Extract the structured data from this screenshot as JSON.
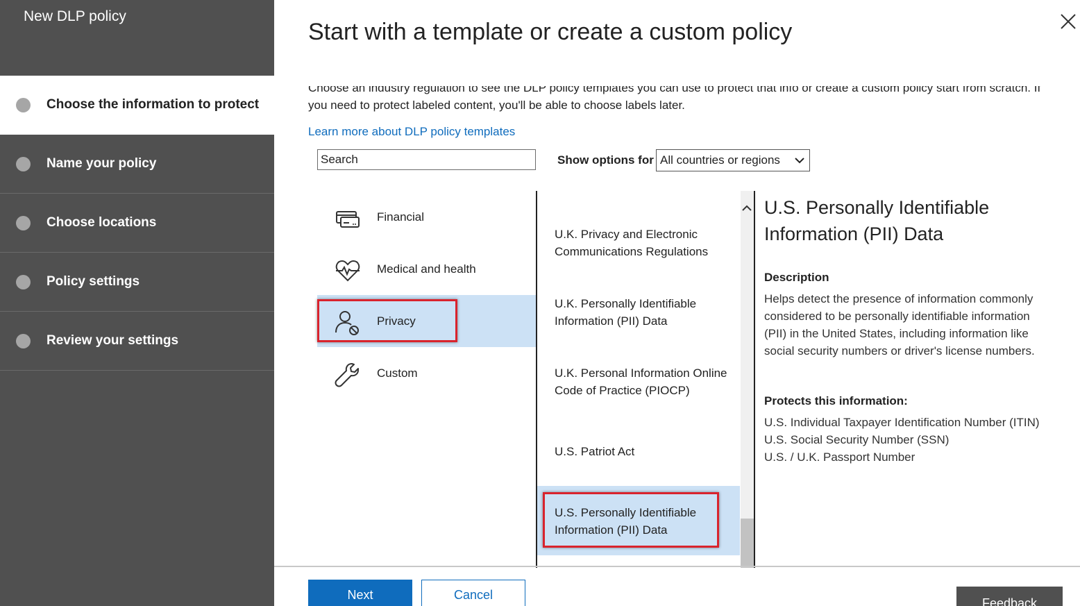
{
  "sidebar": {
    "title": "New DLP policy",
    "steps": [
      {
        "label": "Choose the information to protect",
        "active": true
      },
      {
        "label": "Name your policy"
      },
      {
        "label": "Choose locations"
      },
      {
        "label": "Policy settings"
      },
      {
        "label": "Review your settings"
      }
    ]
  },
  "main": {
    "title": "Start with a template or create a custom policy",
    "intro": "Choose an industry regulation to see the DLP policy templates you can use to protect that info or create a custom policy start from scratch. If you need to protect labeled content, you'll be able to choose labels later.",
    "learn_more": "Learn more about DLP policy templates",
    "search": {
      "value": "Search"
    },
    "show_options_label": "Show options for",
    "region_select": "All countries or regions"
  },
  "categories": [
    {
      "label": "Financial",
      "icon": "credit-card-icon"
    },
    {
      "label": "Medical and health",
      "icon": "heart-pulse-icon"
    },
    {
      "label": "Privacy",
      "icon": "person-blocked-icon",
      "selected": true
    },
    {
      "label": "Custom",
      "icon": "wrench-icon"
    }
  ],
  "templates": [
    {
      "label": "U.K. Privacy and Electronic Communications Regulations"
    },
    {
      "label": "U.K. Personally Identifiable Information (PII) Data"
    },
    {
      "label": "U.K. Personal Information Online Code of Practice (PIOCP)"
    },
    {
      "label": "U.S. Patriot Act"
    },
    {
      "label": "U.S. Personally Identifiable Information (PII) Data",
      "selected": true
    }
  ],
  "details": {
    "title": "U.S. Personally Identifiable Information (PII) Data",
    "description_heading": "Description",
    "description": "Helps detect the presence of information commonly considered to be personally identifiable information (PII) in the United States, including information like social security numbers or driver's license numbers.",
    "protects_heading": "Protects this information:",
    "protects": [
      "U.S. Individual Taxpayer Identification Number (ITIN)",
      "U.S. Social Security Number (SSN)",
      "U.S. / U.K. Passport Number"
    ]
  },
  "footer": {
    "next": "Next",
    "cancel": "Cancel",
    "feedback": "Feedback"
  },
  "colors": {
    "sidebar_bg": "#505050",
    "accent": "#0f6cbd",
    "selected_bg": "#cce1f5",
    "highlight_border": "#d9232d"
  }
}
